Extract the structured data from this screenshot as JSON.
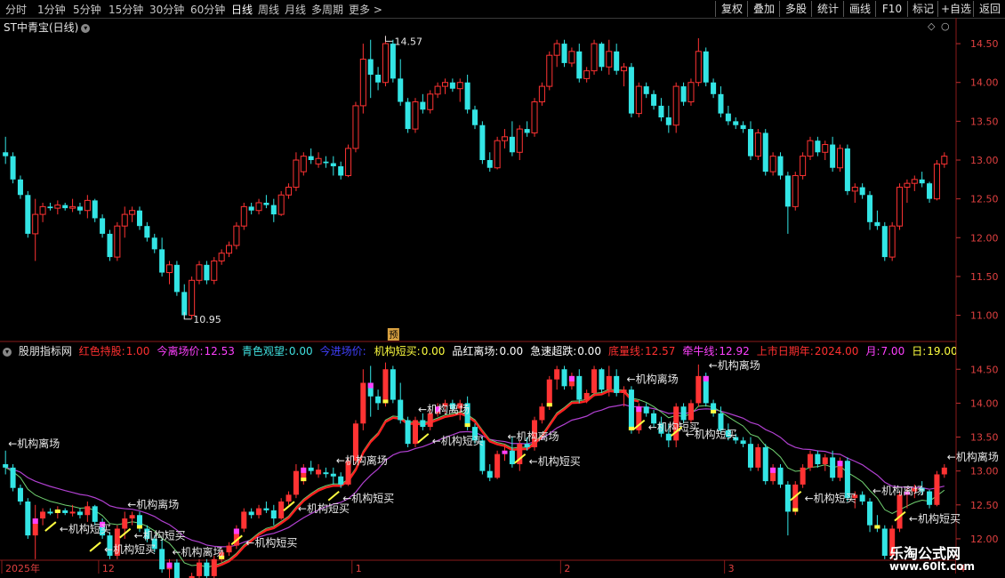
{
  "toolbar": {
    "timeframes": [
      "分时",
      "1分钟",
      "5分钟",
      "15分钟",
      "30分钟",
      "60分钟",
      "日线",
      "周线",
      "月线",
      "多周期",
      "更多"
    ],
    "active_index": 6,
    "buttons": [
      "复权",
      "叠加",
      "多股",
      "统计",
      "画线",
      "F10",
      "标记",
      "+自选",
      "返回"
    ]
  },
  "stock": {
    "title": "ST中青宝(日线)"
  },
  "indicator": {
    "name": "股朋指标网",
    "fields": [
      {
        "label": "红色持股:",
        "value": "1.00",
        "color": "#ff3030"
      },
      {
        "label": "今离场价:",
        "value": "12.53",
        "color": "#ff40ff"
      },
      {
        "label": "青色观望:",
        "value": "0.00",
        "color": "#40e0e0"
      },
      {
        "label": "今进场价:",
        "value": "",
        "color": "#4040ff"
      },
      {
        "label": "机构短买:",
        "value": "0.00",
        "color": "#ffff40"
      },
      {
        "label": "品红离场:",
        "value": "0.00",
        "color": "#ffffff"
      },
      {
        "label": "急速超跌:",
        "value": "0.00",
        "color": "#ffffff"
      },
      {
        "label": "底量线:",
        "value": "12.57",
        "color": "#ff3030"
      },
      {
        "label": "牵牛线:",
        "value": "12.92",
        "color": "#ff40ff"
      },
      {
        "label": "上市日期年:",
        "value": "2024.00",
        "color": "#ff3030"
      },
      {
        "label": "月:",
        "value": "7.00",
        "color": "#ff40ff"
      },
      {
        "label": "日:",
        "value": "19.00",
        "color": "#ffff40"
      },
      {
        "label": ":",
        "value": "12.57",
        "color": "#ffffff"
      }
    ]
  },
  "labels": {
    "leave": "←机构离场",
    "buy": "←机构短买",
    "badge": "预",
    "high": "14.57",
    "low": "10.95"
  },
  "watermark": {
    "line1": "乐淘公式网",
    "line2": "www.60lt.com"
  },
  "colors": {
    "up": "#ff3333",
    "down": "#33e5e5",
    "pink": "#ff40ff",
    "yellow": "#ffff40",
    "white": "#ffffff"
  },
  "chart_data": [
    {
      "type": "candlestick",
      "panel": "main",
      "ylim": [
        10.8,
        14.65
      ],
      "yticks": [
        "14.50",
        "14.00",
        "13.50",
        "13.00",
        "12.50",
        "12.00",
        "11.50",
        "11.00"
      ],
      "ohlc": [
        [
          13.1,
          13.3,
          12.95,
          13.05
        ],
        [
          13.05,
          13.1,
          12.7,
          12.75
        ],
        [
          12.75,
          12.8,
          12.5,
          12.55
        ],
        [
          12.55,
          12.6,
          12.0,
          12.05
        ],
        [
          12.05,
          12.5,
          11.7,
          12.3
        ],
        [
          12.3,
          12.45,
          12.2,
          12.4
        ],
        [
          12.4,
          12.45,
          12.35,
          12.38
        ],
        [
          12.38,
          12.48,
          12.3,
          12.42
        ],
        [
          12.42,
          12.45,
          12.35,
          12.38
        ],
        [
          12.38,
          12.5,
          12.33,
          12.4
        ],
        [
          12.4,
          12.45,
          12.3,
          12.35
        ],
        [
          12.35,
          12.55,
          12.25,
          12.48
        ],
        [
          12.48,
          12.5,
          12.2,
          12.25
        ],
        [
          12.25,
          12.3,
          12.0,
          12.05
        ],
        [
          12.05,
          12.1,
          11.7,
          11.75
        ],
        [
          11.75,
          12.2,
          11.7,
          12.15
        ],
        [
          12.15,
          12.4,
          12.0,
          12.3
        ],
        [
          12.3,
          12.4,
          12.2,
          12.35
        ],
        [
          12.35,
          12.4,
          12.1,
          12.15
        ],
        [
          12.15,
          12.2,
          11.95,
          12.0
        ],
        [
          12.0,
          12.05,
          11.8,
          11.85
        ],
        [
          11.85,
          12.0,
          11.5,
          11.55
        ],
        [
          11.55,
          11.7,
          11.4,
          11.65
        ],
        [
          11.65,
          11.7,
          11.25,
          11.3
        ],
        [
          11.3,
          11.4,
          10.95,
          11.0
        ],
        [
          11.0,
          11.5,
          10.95,
          11.45
        ],
        [
          11.45,
          11.7,
          11.4,
          11.65
        ],
        [
          11.65,
          11.7,
          11.4,
          11.45
        ],
        [
          11.45,
          11.75,
          11.4,
          11.7
        ],
        [
          11.7,
          11.85,
          11.65,
          11.8
        ],
        [
          11.8,
          11.95,
          11.75,
          11.9
        ],
        [
          11.9,
          12.2,
          11.85,
          12.15
        ],
        [
          12.15,
          12.45,
          12.1,
          12.4
        ],
        [
          12.4,
          12.45,
          12.3,
          12.35
        ],
        [
          12.35,
          12.5,
          12.3,
          12.45
        ],
        [
          12.45,
          12.55,
          12.38,
          12.42
        ],
        [
          12.42,
          12.5,
          12.2,
          12.3
        ],
        [
          12.3,
          12.6,
          12.28,
          12.55
        ],
        [
          12.55,
          12.7,
          12.5,
          12.65
        ],
        [
          12.65,
          13.1,
          12.6,
          13.0
        ],
        [
          12.85,
          13.1,
          12.8,
          13.05
        ],
        [
          13.05,
          13.15,
          12.95,
          13.0
        ],
        [
          12.95,
          13.1,
          12.9,
          13.02
        ],
        [
          12.98,
          13.05,
          12.9,
          12.96
        ],
        [
          12.96,
          13.05,
          12.8,
          12.92
        ],
        [
          12.92,
          12.98,
          12.75,
          12.8
        ],
        [
          12.8,
          13.2,
          12.78,
          13.15
        ],
        [
          13.15,
          13.75,
          13.1,
          13.7
        ],
        [
          13.7,
          14.5,
          13.6,
          14.3
        ],
        [
          14.3,
          14.55,
          13.8,
          14.1
        ],
        [
          14.1,
          14.2,
          13.9,
          14.0
        ],
        [
          14.0,
          14.6,
          13.95,
          14.5
        ],
        [
          14.5,
          14.55,
          14.0,
          14.05
        ],
        [
          14.05,
          14.3,
          13.7,
          13.75
        ],
        [
          13.75,
          13.8,
          13.35,
          13.4
        ],
        [
          13.4,
          13.8,
          13.35,
          13.75
        ],
        [
          13.75,
          13.85,
          13.6,
          13.65
        ],
        [
          13.65,
          13.9,
          13.6,
          13.85
        ],
        [
          13.85,
          14.0,
          13.8,
          13.95
        ],
        [
          13.95,
          14.05,
          13.85,
          14.0
        ],
        [
          14.0,
          14.05,
          13.88,
          13.92
        ],
        [
          13.92,
          14.05,
          13.75,
          14.0
        ],
        [
          14.0,
          14.1,
          13.6,
          13.65
        ],
        [
          13.65,
          13.7,
          13.4,
          13.45
        ],
        [
          13.45,
          13.5,
          12.95,
          13.0
        ],
        [
          13.0,
          13.1,
          12.85,
          12.9
        ],
        [
          12.9,
          13.3,
          12.88,
          13.25
        ],
        [
          13.25,
          13.4,
          13.15,
          13.3
        ],
        [
          13.3,
          13.5,
          13.05,
          13.1
        ],
        [
          13.1,
          13.45,
          13.0,
          13.4
        ],
        [
          13.4,
          13.5,
          13.3,
          13.35
        ],
        [
          13.35,
          13.8,
          13.3,
          13.75
        ],
        [
          13.75,
          14.0,
          13.7,
          13.95
        ],
        [
          13.95,
          14.4,
          13.9,
          14.35
        ],
        [
          14.35,
          14.55,
          14.2,
          14.5
        ],
        [
          14.5,
          14.55,
          14.2,
          14.25
        ],
        [
          14.25,
          14.45,
          14.2,
          14.4
        ],
        [
          14.4,
          14.5,
          14.0,
          14.05
        ],
        [
          14.05,
          14.2,
          14.0,
          14.15
        ],
        [
          14.15,
          14.55,
          14.1,
          14.5
        ],
        [
          14.5,
          14.52,
          14.15,
          14.2
        ],
        [
          14.2,
          14.55,
          14.1,
          14.4
        ],
        [
          14.4,
          14.5,
          14.1,
          14.15
        ],
        [
          14.15,
          14.25,
          13.95,
          14.2
        ],
        [
          14.2,
          14.25,
          13.55,
          13.6
        ],
        [
          13.6,
          14.0,
          13.55,
          13.95
        ],
        [
          13.95,
          14.0,
          13.8,
          13.85
        ],
        [
          13.85,
          13.9,
          13.65,
          13.7
        ],
        [
          13.7,
          13.8,
          13.5,
          13.55
        ],
        [
          13.55,
          13.7,
          13.35,
          13.45
        ],
        [
          13.45,
          14.0,
          13.35,
          13.95
        ],
        [
          13.95,
          14.0,
          13.7,
          13.75
        ],
        [
          13.75,
          14.05,
          13.7,
          14.0
        ],
        [
          14.0,
          14.57,
          13.95,
          14.4
        ],
        [
          14.4,
          14.45,
          13.95,
          14.0
        ],
        [
          14.0,
          14.05,
          13.8,
          13.85
        ],
        [
          13.85,
          13.95,
          13.55,
          13.6
        ],
        [
          13.6,
          13.7,
          13.45,
          13.5
        ],
        [
          13.5,
          13.55,
          13.4,
          13.45
        ],
        [
          13.45,
          13.5,
          13.35,
          13.4
        ],
        [
          13.4,
          13.5,
          13.0,
          13.05
        ],
        [
          13.05,
          13.4,
          13.0,
          13.35
        ],
        [
          13.35,
          13.4,
          12.8,
          12.85
        ],
        [
          12.85,
          13.1,
          12.8,
          13.05
        ],
        [
          13.05,
          13.1,
          12.75,
          12.8
        ],
        [
          12.8,
          12.85,
          12.05,
          12.4
        ],
        [
          12.4,
          12.85,
          12.35,
          12.8
        ],
        [
          12.8,
          13.1,
          12.75,
          13.05
        ],
        [
          13.05,
          13.3,
          13.0,
          13.25
        ],
        [
          13.25,
          13.3,
          13.05,
          13.1
        ],
        [
          13.1,
          13.25,
          13.0,
          13.2
        ],
        [
          13.2,
          13.3,
          12.85,
          12.9
        ],
        [
          12.9,
          13.2,
          12.85,
          13.15
        ],
        [
          13.15,
          13.2,
          12.55,
          12.6
        ],
        [
          12.6,
          12.7,
          12.45,
          12.65
        ],
        [
          12.65,
          12.7,
          12.5,
          12.55
        ],
        [
          12.55,
          12.6,
          12.1,
          12.2
        ],
        [
          12.2,
          12.35,
          12.1,
          12.15
        ],
        [
          12.15,
          12.2,
          11.7,
          11.75
        ],
        [
          11.75,
          12.2,
          11.7,
          12.15
        ],
        [
          12.15,
          12.7,
          12.1,
          12.65
        ],
        [
          12.65,
          12.75,
          12.45,
          12.7
        ],
        [
          12.7,
          12.8,
          12.6,
          12.75
        ],
        [
          12.75,
          12.85,
          12.65,
          12.7
        ],
        [
          12.7,
          12.72,
          12.45,
          12.5
        ],
        [
          12.5,
          13.0,
          12.48,
          12.95
        ],
        [
          12.95,
          13.1,
          12.9,
          13.05
        ]
      ]
    },
    {
      "type": "candlestick",
      "panel": "indicator",
      "ylim": [
        11.75,
        14.7
      ],
      "yticks": [
        "14.50",
        "14.00",
        "13.50",
        "13.00",
        "12.50",
        "12.00"
      ],
      "ma_slow_label": "牵牛线",
      "ma_fast_label": "底量线"
    }
  ],
  "x_axis": {
    "labels": [
      "2025年",
      "12",
      "1",
      "2",
      "3",
      "4"
    ],
    "label_index": [
      0,
      13,
      47,
      75,
      97,
      128
    ]
  }
}
